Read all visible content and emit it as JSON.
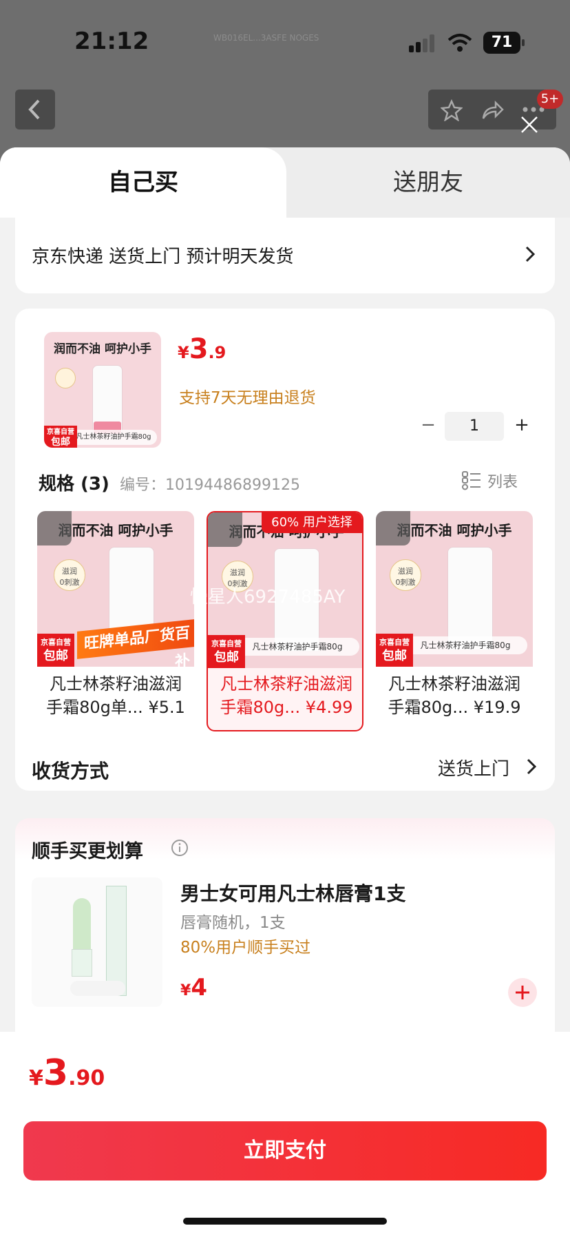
{
  "status_bar": {
    "time": "21:12",
    "watermark": "WB016EL...3ASFE NOGES",
    "battery": "71"
  },
  "header": {
    "notification_badge": "5+"
  },
  "tabs": {
    "self": "自己买",
    "gift": "送朋友"
  },
  "delivery": {
    "text": "京东快递 送货上门 预计明天发货"
  },
  "product": {
    "thumb_title": "润而不油 呵护小手",
    "thumb_tube_label": "凡士林茶籽油护手霜80g",
    "badge_top": "京喜自营",
    "badge_bottom": "包邮",
    "price_symbol": "¥",
    "price_int": "3",
    "price_dec": ".9",
    "return_policy": "支持7天无理由退货",
    "quantity": "1",
    "minus": "−",
    "plus": "+"
  },
  "specs": {
    "title": "规格 (3)",
    "code": "编号：10194486899125",
    "list_label": "列表",
    "popular_tag": "60% 用户选择",
    "watermark": "慢星人6927485AY",
    "banner": "旺牌单品厂货百补",
    "items": [
      {
        "line1": "凡士林茶籽油滋润",
        "line2": "手霜80g单...",
        "price": "¥5.1"
      },
      {
        "line1": "凡士林茶籽油滋润",
        "line2": "手霜80g...",
        "price": "¥4.99"
      },
      {
        "line1": "凡士林茶籽油滋润",
        "line2": "手霜80g...",
        "price": "¥19.9"
      }
    ],
    "img_badges": [
      "滋润",
      "0刺激"
    ]
  },
  "receive": {
    "label": "收货方式",
    "value": "送货上门"
  },
  "addon": {
    "title": "顺手买更划算",
    "name": "男士女可用凡士林唇膏1支",
    "desc": "唇膏随机，1支",
    "stat": "80%用户顺手买过",
    "price_symbol": "¥",
    "price": "4"
  },
  "footer": {
    "price_symbol": "¥",
    "price_int": "3",
    "price_dec": ".90",
    "pay_label": "立即支付"
  },
  "colors": {
    "accent": "#e4191e",
    "orange": "#c8801e",
    "gray": "#888888"
  }
}
